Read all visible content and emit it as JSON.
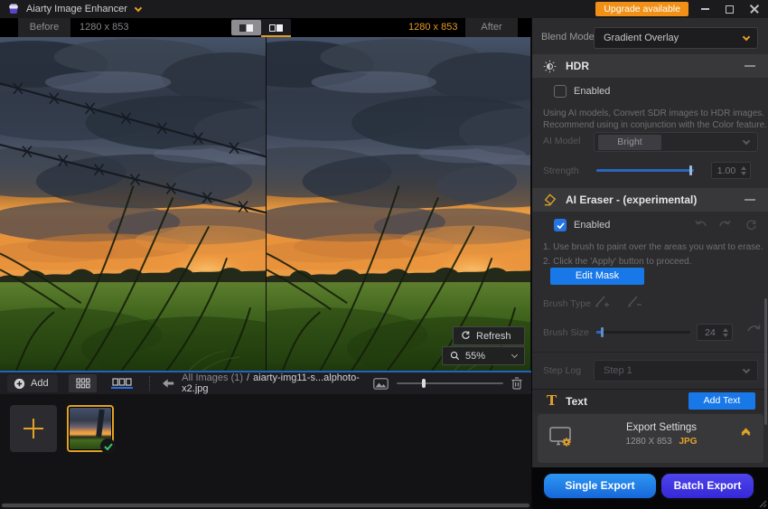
{
  "titlebar": {
    "app_title": "Aiarty Image Enhancer",
    "upgrade": "Upgrade available"
  },
  "viewer": {
    "before_label": "Before",
    "before_size": "1280 x 853",
    "after_size": "1280 x 853",
    "after_label": "After",
    "refresh": "Refresh",
    "zoom": "55%"
  },
  "panel": {
    "blend": {
      "label": "Blend Mode",
      "value": "Gradient Overlay"
    },
    "hdr": {
      "title": "HDR",
      "enabled": "Enabled",
      "desc1": "Using AI models, Convert SDR images to HDR images.",
      "desc2": "Recommend using in conjunction with the Color feature.",
      "model_label": "AI Model",
      "model_value": "Bright",
      "strength_label": "Strength",
      "strength_value": "1.00"
    },
    "eraser": {
      "title": "AI Eraser - (experimental)",
      "enabled": "Enabled",
      "step1": "1. Use brush to paint over the areas you want to erase.",
      "step2": "2. Click the 'Apply' button to proceed.",
      "edit_mask": "Edit Mask",
      "brush_type_label": "Brush Type",
      "brush_size_label": "Brush Size",
      "brush_size_value": "24",
      "step_log_label": "Step Log",
      "step_log_value": "Step 1"
    },
    "text": {
      "title": "Text",
      "icon_glyph": "T",
      "add_button": "Add Text"
    },
    "export": {
      "title": "Export Settings",
      "size": "1280 X 853",
      "format": "JPG",
      "single": "Single Export",
      "batch": "Batch Export"
    }
  },
  "toolbar": {
    "add": "Add",
    "breadcrumb_root": "All Images (1)",
    "breadcrumb_sep": "/",
    "filename": "aiarty-img11-s...alphoto-x2.jpg"
  },
  "colors": {
    "accent_orange": "#e2a226",
    "action_blue": "#1878e8",
    "batch_purple": "#4336e0",
    "upgrade_orange": "#f09016"
  }
}
